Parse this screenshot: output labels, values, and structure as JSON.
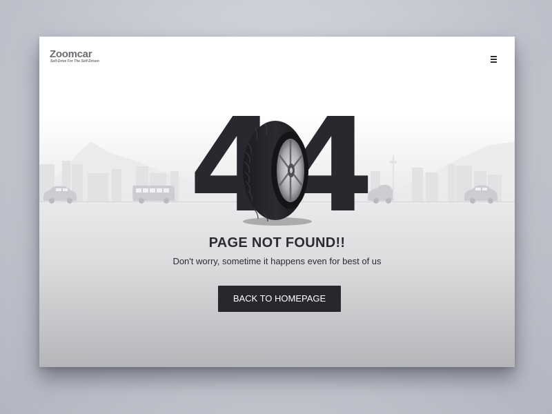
{
  "brand": {
    "name": "Zoomcar",
    "tagline": "Self-Drive For The Self-Driven"
  },
  "header": {
    "menu_icon": "hamburger-menu-icon"
  },
  "error": {
    "code_left": "4",
    "code_right": "4",
    "title": "PAGE NOT FOUND!!",
    "message": "Don't worry, sometime it happens even for best of us"
  },
  "actions": {
    "home_label": "BACK TO HOMEPAGE"
  },
  "colors": {
    "dark": "#27282d",
    "text": "#2b2c31",
    "logo_grey": "#6b6d73"
  }
}
